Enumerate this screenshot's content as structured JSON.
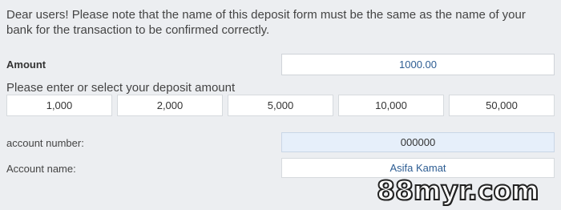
{
  "notice": "Dear users! Please note that the name of this deposit form must be the same as the name of your bank for the transaction to be confirmed correctly.",
  "amount": {
    "label": "Amount",
    "value": "1000.00"
  },
  "prompt": "Please enter or select your deposit amount",
  "quick_amounts": [
    "1,000",
    "2,000",
    "5,000",
    "10,000",
    "50,000"
  ],
  "account_number": {
    "label": "account number:",
    "value": "000000"
  },
  "account_name": {
    "label": "Account name:",
    "value": "Asifa Kamat"
  },
  "watermark": "88myr.com"
}
